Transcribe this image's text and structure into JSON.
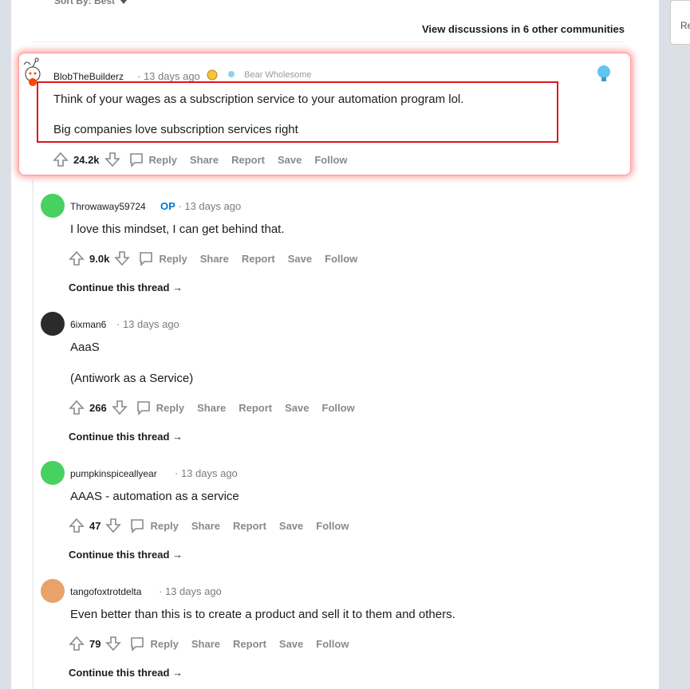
{
  "sort": {
    "label": "Sort By: Best"
  },
  "view_discussions": "View discussions in 6 other communities",
  "side_card_text": "Re",
  "highlighted": {
    "username": "BlobTheBuilderz",
    "time": "13 days ago",
    "award_text": "Bear Wholesome",
    "lines": [
      "Think of your wages as a subscription service to your automation program lol.",
      "Big companies love subscription services right"
    ],
    "votes": "24.2k"
  },
  "actions": {
    "reply": "Reply",
    "share": "Share",
    "report": "Report",
    "save": "Save",
    "follow": "Follow"
  },
  "continue_label": "Continue this thread",
  "op_badge": "OP",
  "comments": [
    {
      "username": "Throwaway59724",
      "op": true,
      "time": "13 days ago",
      "lines": [
        "I love this mindset, I can get behind that."
      ],
      "votes": "9.0k",
      "avatar_color": "#46d160"
    },
    {
      "username": "6ixman6",
      "op": false,
      "time": "13 days ago",
      "lines": [
        "AaaS",
        "(Antiwork as a Service)"
      ],
      "votes": "266",
      "avatar_color": "#2b2b2b"
    },
    {
      "username": "pumpkinspiceallyear",
      "op": false,
      "time": "13 days ago",
      "lines": [
        "AAAS - automation as a service"
      ],
      "votes": "47",
      "avatar_color": "#46d160"
    },
    {
      "username": "tangofoxtrotdelta",
      "op": false,
      "time": "13 days ago",
      "lines": [
        "Even better than this is to create a product and sell it to them and others."
      ],
      "votes": "79",
      "avatar_color": "#e8a36a"
    }
  ]
}
